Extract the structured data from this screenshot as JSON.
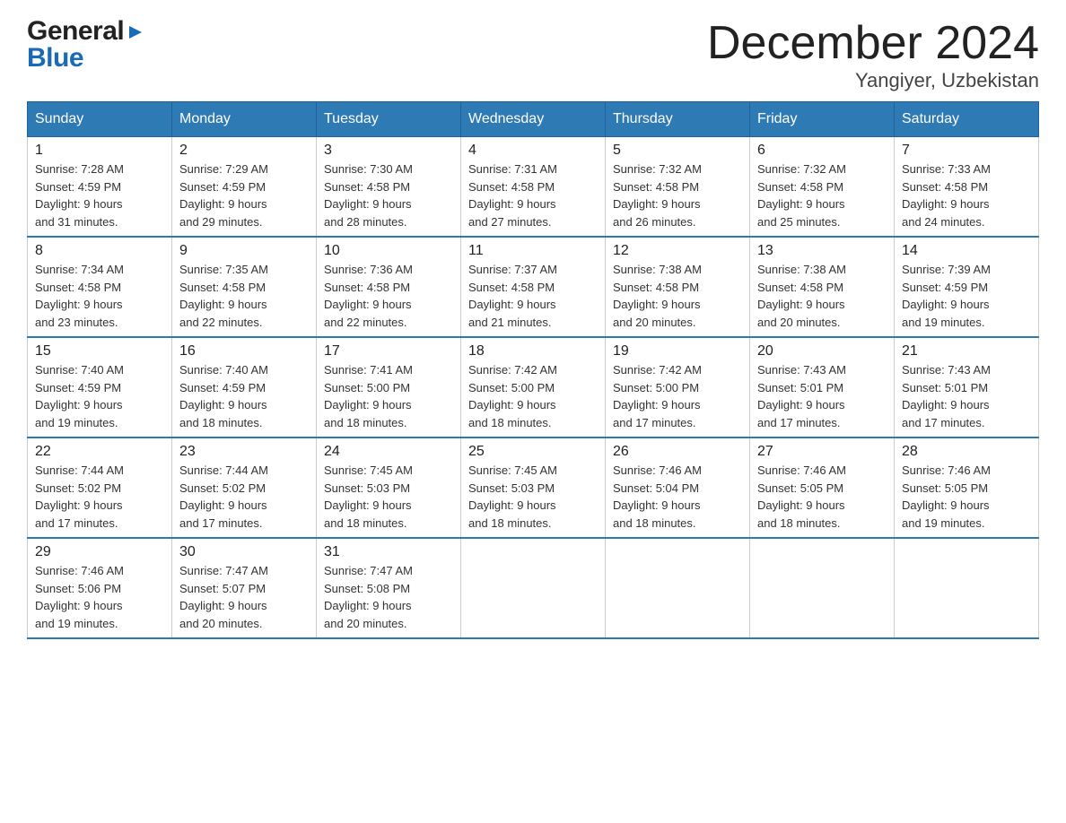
{
  "header": {
    "logo_general": "General",
    "logo_arrow": "▶",
    "logo_blue": "Blue",
    "month_title": "December 2024",
    "location": "Yangiyer, Uzbekistan"
  },
  "days_of_week": [
    "Sunday",
    "Monday",
    "Tuesday",
    "Wednesday",
    "Thursday",
    "Friday",
    "Saturday"
  ],
  "weeks": [
    [
      {
        "day": "1",
        "sunrise": "7:28 AM",
        "sunset": "4:59 PM",
        "daylight": "9 hours and 31 minutes."
      },
      {
        "day": "2",
        "sunrise": "7:29 AM",
        "sunset": "4:59 PM",
        "daylight": "9 hours and 29 minutes."
      },
      {
        "day": "3",
        "sunrise": "7:30 AM",
        "sunset": "4:58 PM",
        "daylight": "9 hours and 28 minutes."
      },
      {
        "day": "4",
        "sunrise": "7:31 AM",
        "sunset": "4:58 PM",
        "daylight": "9 hours and 27 minutes."
      },
      {
        "day": "5",
        "sunrise": "7:32 AM",
        "sunset": "4:58 PM",
        "daylight": "9 hours and 26 minutes."
      },
      {
        "day": "6",
        "sunrise": "7:32 AM",
        "sunset": "4:58 PM",
        "daylight": "9 hours and 25 minutes."
      },
      {
        "day": "7",
        "sunrise": "7:33 AM",
        "sunset": "4:58 PM",
        "daylight": "9 hours and 24 minutes."
      }
    ],
    [
      {
        "day": "8",
        "sunrise": "7:34 AM",
        "sunset": "4:58 PM",
        "daylight": "9 hours and 23 minutes."
      },
      {
        "day": "9",
        "sunrise": "7:35 AM",
        "sunset": "4:58 PM",
        "daylight": "9 hours and 22 minutes."
      },
      {
        "day": "10",
        "sunrise": "7:36 AM",
        "sunset": "4:58 PM",
        "daylight": "9 hours and 22 minutes."
      },
      {
        "day": "11",
        "sunrise": "7:37 AM",
        "sunset": "4:58 PM",
        "daylight": "9 hours and 21 minutes."
      },
      {
        "day": "12",
        "sunrise": "7:38 AM",
        "sunset": "4:58 PM",
        "daylight": "9 hours and 20 minutes."
      },
      {
        "day": "13",
        "sunrise": "7:38 AM",
        "sunset": "4:58 PM",
        "daylight": "9 hours and 20 minutes."
      },
      {
        "day": "14",
        "sunrise": "7:39 AM",
        "sunset": "4:59 PM",
        "daylight": "9 hours and 19 minutes."
      }
    ],
    [
      {
        "day": "15",
        "sunrise": "7:40 AM",
        "sunset": "4:59 PM",
        "daylight": "9 hours and 19 minutes."
      },
      {
        "day": "16",
        "sunrise": "7:40 AM",
        "sunset": "4:59 PM",
        "daylight": "9 hours and 18 minutes."
      },
      {
        "day": "17",
        "sunrise": "7:41 AM",
        "sunset": "5:00 PM",
        "daylight": "9 hours and 18 minutes."
      },
      {
        "day": "18",
        "sunrise": "7:42 AM",
        "sunset": "5:00 PM",
        "daylight": "9 hours and 18 minutes."
      },
      {
        "day": "19",
        "sunrise": "7:42 AM",
        "sunset": "5:00 PM",
        "daylight": "9 hours and 17 minutes."
      },
      {
        "day": "20",
        "sunrise": "7:43 AM",
        "sunset": "5:01 PM",
        "daylight": "9 hours and 17 minutes."
      },
      {
        "day": "21",
        "sunrise": "7:43 AM",
        "sunset": "5:01 PM",
        "daylight": "9 hours and 17 minutes."
      }
    ],
    [
      {
        "day": "22",
        "sunrise": "7:44 AM",
        "sunset": "5:02 PM",
        "daylight": "9 hours and 17 minutes."
      },
      {
        "day": "23",
        "sunrise": "7:44 AM",
        "sunset": "5:02 PM",
        "daylight": "9 hours and 17 minutes."
      },
      {
        "day": "24",
        "sunrise": "7:45 AM",
        "sunset": "5:03 PM",
        "daylight": "9 hours and 18 minutes."
      },
      {
        "day": "25",
        "sunrise": "7:45 AM",
        "sunset": "5:03 PM",
        "daylight": "9 hours and 18 minutes."
      },
      {
        "day": "26",
        "sunrise": "7:46 AM",
        "sunset": "5:04 PM",
        "daylight": "9 hours and 18 minutes."
      },
      {
        "day": "27",
        "sunrise": "7:46 AM",
        "sunset": "5:05 PM",
        "daylight": "9 hours and 18 minutes."
      },
      {
        "day": "28",
        "sunrise": "7:46 AM",
        "sunset": "5:05 PM",
        "daylight": "9 hours and 19 minutes."
      }
    ],
    [
      {
        "day": "29",
        "sunrise": "7:46 AM",
        "sunset": "5:06 PM",
        "daylight": "9 hours and 19 minutes."
      },
      {
        "day": "30",
        "sunrise": "7:47 AM",
        "sunset": "5:07 PM",
        "daylight": "9 hours and 20 minutes."
      },
      {
        "day": "31",
        "sunrise": "7:47 AM",
        "sunset": "5:08 PM",
        "daylight": "9 hours and 20 minutes."
      },
      null,
      null,
      null,
      null
    ]
  ],
  "labels": {
    "sunrise": "Sunrise:",
    "sunset": "Sunset:",
    "daylight": "Daylight:"
  }
}
